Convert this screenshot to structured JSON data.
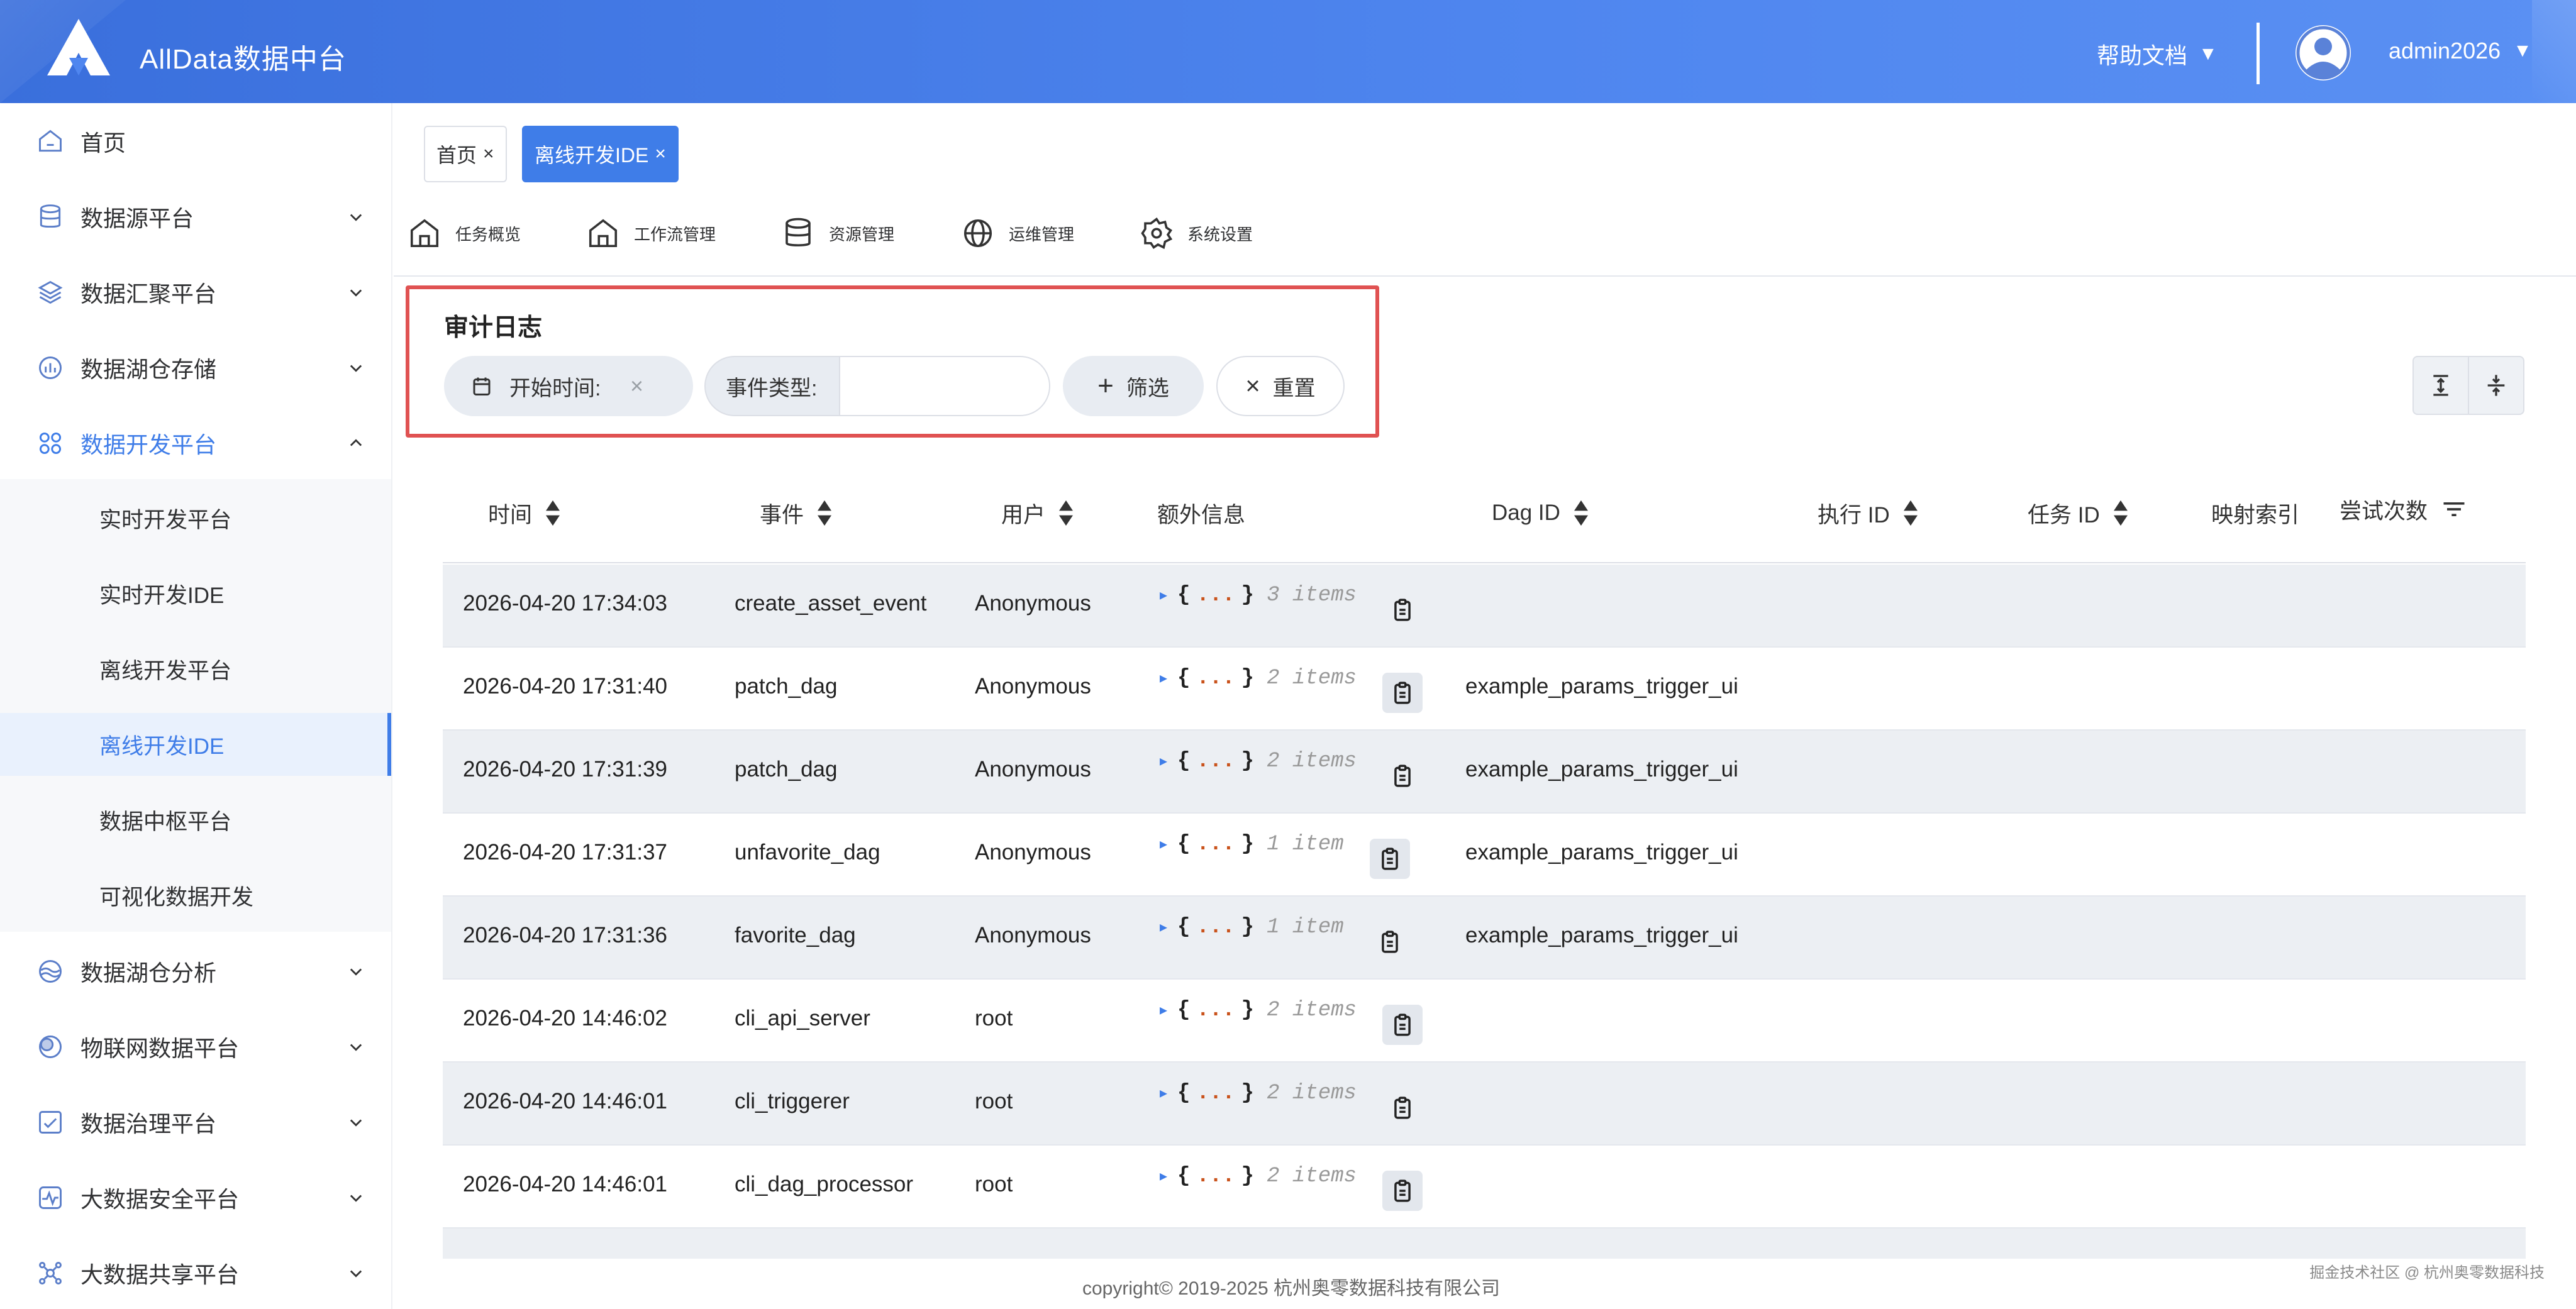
{
  "header": {
    "app_title": "AllData数据中台",
    "help_label": "帮助文档",
    "username": "admin2026",
    "caret": "▼"
  },
  "sidebar": {
    "items": [
      {
        "label": "首页",
        "icon": "home-icon"
      },
      {
        "label": "数据源平台",
        "icon": "database-icon"
      },
      {
        "label": "数据汇聚平台",
        "icon": "layers-icon"
      },
      {
        "label": "数据湖仓存储",
        "icon": "chart-icon"
      },
      {
        "label": "数据开发平台",
        "icon": "grid-icon",
        "expanded": true
      },
      {
        "label": "数据湖仓分析",
        "icon": "lake-icon"
      },
      {
        "label": "物联网数据平台",
        "icon": "iot-icon"
      },
      {
        "label": "数据治理平台",
        "icon": "governance-icon"
      },
      {
        "label": "大数据安全平台",
        "icon": "security-icon"
      },
      {
        "label": "大数据共享平台",
        "icon": "share-icon"
      }
    ],
    "subitems": [
      {
        "label": "实时开发平台"
      },
      {
        "label": "实时开发IDE"
      },
      {
        "label": "离线开发平台"
      },
      {
        "label": "离线开发IDE",
        "selected": true
      },
      {
        "label": "数据中枢平台"
      },
      {
        "label": "可视化数据开发"
      }
    ]
  },
  "tabs": [
    {
      "label": "首页",
      "close": "×"
    },
    {
      "label": "离线开发IDE",
      "close": "×",
      "active": true
    }
  ],
  "toolbar": [
    {
      "label": "任务概览",
      "icon": "home-outline-icon"
    },
    {
      "label": "工作流管理",
      "icon": "workflow-icon"
    },
    {
      "label": "资源管理",
      "icon": "database-icon"
    },
    {
      "label": "运维管理",
      "icon": "globe-icon"
    },
    {
      "label": "系统设置",
      "icon": "gear-icon"
    }
  ],
  "audit": {
    "title": "审计日志",
    "start_time_label": "开始时间:",
    "clear": "×",
    "event_type_label": "事件类型:",
    "event_type_value": "",
    "filter_label": "筛选",
    "reset_label": "重置",
    "plus": "+",
    "times": "×"
  },
  "table": {
    "columns": [
      "时间",
      "事件",
      "用户",
      "额外信息",
      "Dag ID",
      "执行 ID",
      "任务 ID",
      "映射索引",
      "尝试次数"
    ],
    "rows": [
      {
        "time": "2026-04-20 17:34:03",
        "event": "create_asset_event",
        "user": "Anonymous",
        "extra": "3 items",
        "dag_id": ""
      },
      {
        "time": "2026-04-20 17:31:40",
        "event": "patch_dag",
        "user": "Anonymous",
        "extra": "2 items",
        "dag_id": "example_params_trigger_ui"
      },
      {
        "time": "2026-04-20 17:31:39",
        "event": "patch_dag",
        "user": "Anonymous",
        "extra": "2 items",
        "dag_id": "example_params_trigger_ui"
      },
      {
        "time": "2026-04-20 17:31:37",
        "event": "unfavorite_dag",
        "user": "Anonymous",
        "extra": "1 item",
        "dag_id": "example_params_trigger_ui"
      },
      {
        "time": "2026-04-20 17:31:36",
        "event": "favorite_dag",
        "user": "Anonymous",
        "extra": "1 item",
        "dag_id": "example_params_trigger_ui"
      },
      {
        "time": "2026-04-20 14:46:02",
        "event": "cli_api_server",
        "user": "root",
        "extra": "2 items",
        "dag_id": ""
      },
      {
        "time": "2026-04-20 14:46:01",
        "event": "cli_triggerer",
        "user": "root",
        "extra": "2 items",
        "dag_id": ""
      },
      {
        "time": "2026-04-20 14:46:01",
        "event": "cli_dag_processor",
        "user": "root",
        "extra": "2 items",
        "dag_id": ""
      }
    ],
    "json_open": "{",
    "json_dots": "...",
    "json_close": "}",
    "expand_arrow": "▶"
  },
  "footer": {
    "copyright": "copyright© 2019-2025 杭州奥零数据科技有限公司",
    "watermark": "掘金技术社区 @ 杭州奥零数据科技"
  },
  "colors": {
    "primary": "#3f7de8",
    "header_gradient_start": "#3a6fdc",
    "highlight_border": "#e05252",
    "row_stripe": "#eceff3"
  }
}
